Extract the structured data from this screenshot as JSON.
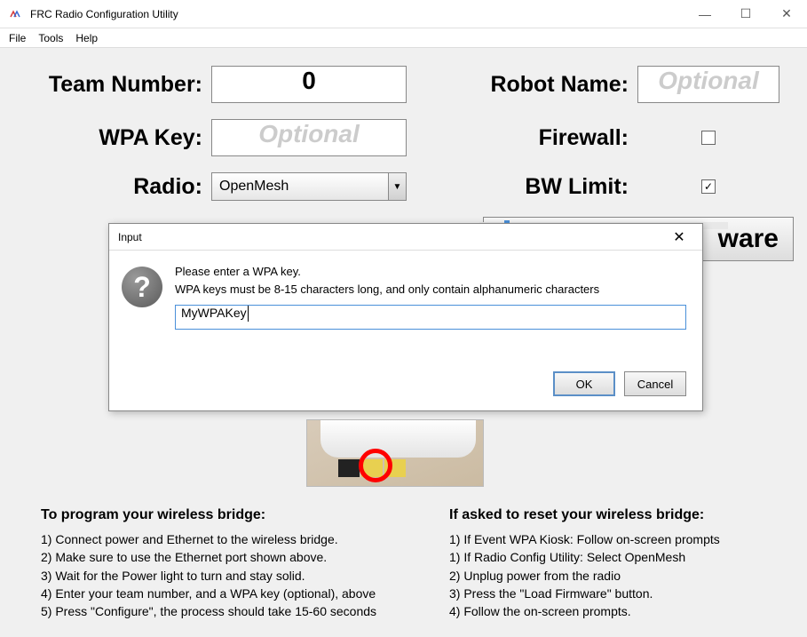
{
  "titlebar": {
    "title": "FRC Radio Configuration Utility"
  },
  "menu": {
    "file": "File",
    "tools": "Tools",
    "help": "Help"
  },
  "labels": {
    "team_number": "Team Number:",
    "robot_name": "Robot Name:",
    "wpa_key": "WPA Key:",
    "firewall": "Firewall:",
    "radio": "Radio:",
    "bw_limit": "BW Limit:"
  },
  "values": {
    "team_number": "0",
    "robot_name_placeholder": "Optional",
    "wpa_key_placeholder": "Optional",
    "radio_selected": "OpenMesh",
    "firewall_checked": "",
    "bw_limit_checked": "✓"
  },
  "buttons": {
    "load_firmware": "ware"
  },
  "instructions": {
    "left_title": "To program your wireless bridge:",
    "left": [
      "1) Connect power and Ethernet to the wireless bridge.",
      "2) Make sure to use the Ethernet port shown above.",
      "3) Wait for the Power light to turn and stay solid.",
      "4) Enter your team number, and a WPA key (optional), above",
      "5) Press \"Configure\", the process should take 15-60 seconds"
    ],
    "right_title": "If asked to reset your wireless bridge:",
    "right": [
      "1) If Event WPA Kiosk: Follow on-screen prompts",
      "1) If Radio Config Utility: Select OpenMesh",
      "2) Unplug power from the radio",
      "3) Press the \"Load Firmware\" button.",
      "4) Follow the on-screen prompts."
    ]
  },
  "dialog": {
    "title": "Input",
    "msg1": "Please enter a WPA key.",
    "msg2": "WPA keys must be 8-15 characters long, and only contain alphanumeric characters",
    "input_value": "MyWPAKey",
    "ok": "OK",
    "cancel": "Cancel"
  }
}
